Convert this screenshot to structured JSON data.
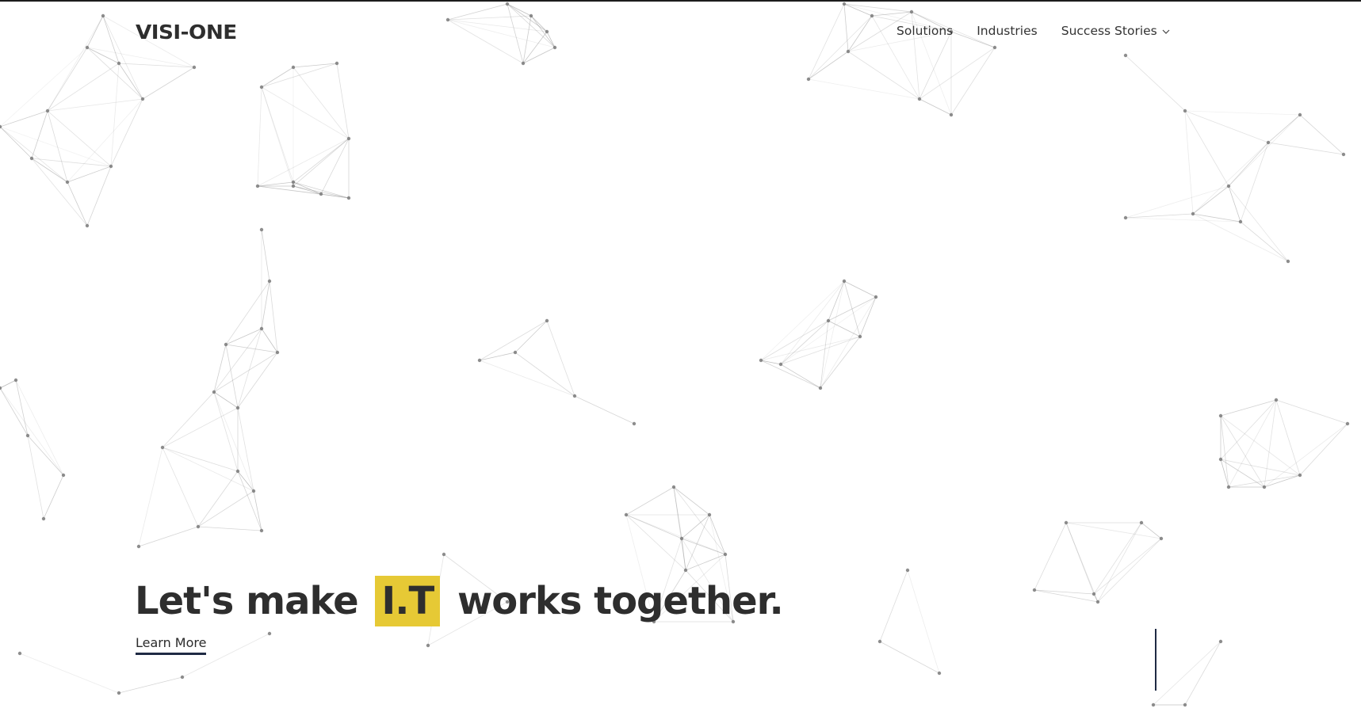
{
  "brand": {
    "logo_text": "VISI-ONE"
  },
  "nav": {
    "items": [
      {
        "label": "Solutions"
      },
      {
        "label": "Industries"
      },
      {
        "label": "Success Stories",
        "has_dropdown": true
      }
    ]
  },
  "hero": {
    "headline_before": "Let's make",
    "headline_highlight": "I.T",
    "headline_after": "works together.",
    "cta_label": "Learn More"
  },
  "colors": {
    "highlight": "#e6c935",
    "accent_navy": "#1f2a44",
    "text": "#2e2e2e",
    "network_lines": "#9a9a9a"
  },
  "icons": [
    "chevron-down-icon"
  ]
}
